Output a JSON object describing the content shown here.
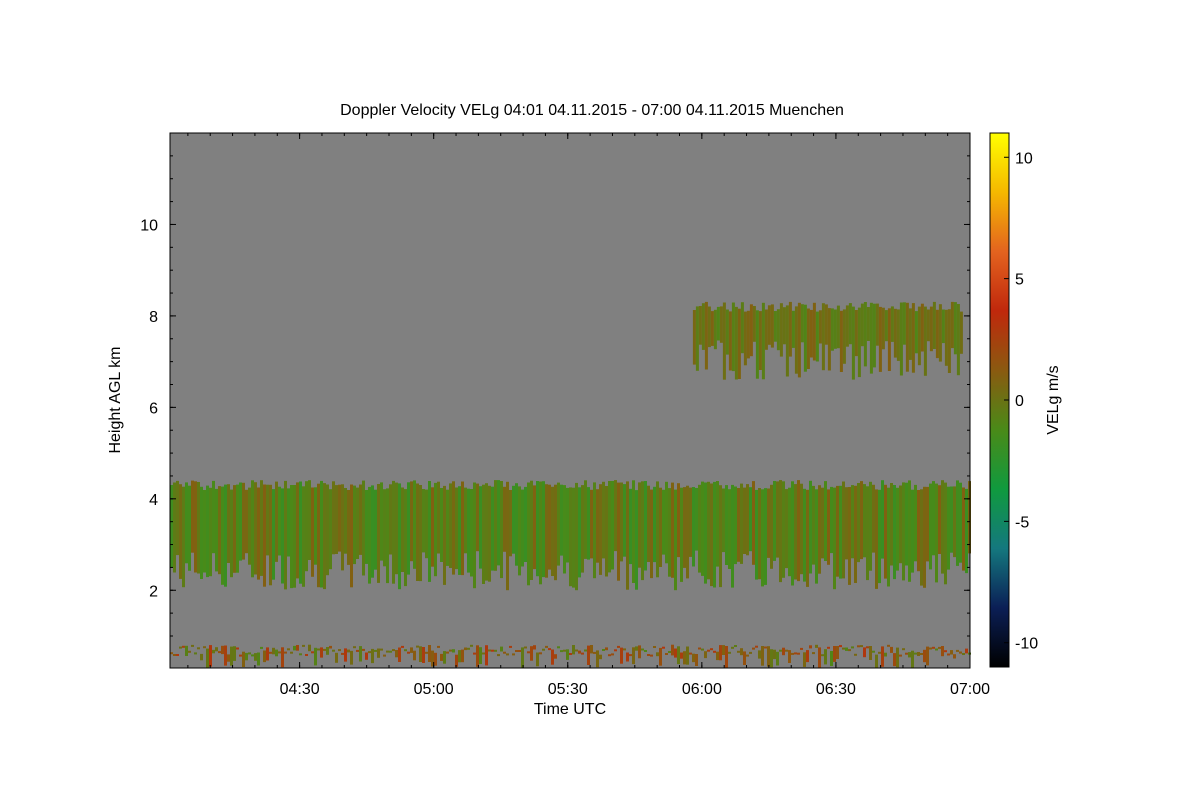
{
  "chart_data": {
    "type": "heatmap",
    "title": "Doppler Velocity VELg   04:01 04.11.2015 - 07:00 04.11.2015 Muenchen",
    "xlabel": "Time UTC",
    "ylabel": "Height AGL km",
    "xlim": [
      "04:01",
      "07:00"
    ],
    "ylim": [
      0.3,
      12.0
    ],
    "xticks": [
      "04:30",
      "05:00",
      "05:30",
      "06:00",
      "06:30",
      "07:00"
    ],
    "yticks": [
      2,
      4,
      6,
      8,
      10
    ],
    "colorbar": {
      "label": "VELg m/s",
      "range": [
        -11,
        11
      ],
      "ticks": [
        -10,
        -5,
        0,
        5,
        10
      ],
      "colors": [
        "#000000",
        "#0b1f56",
        "#14787e",
        "#109a3e",
        "#4a8a18",
        "#8a5a10",
        "#c0280c",
        "#e3631f",
        "#f5b800",
        "#ffff00"
      ]
    },
    "background_color": "#808080",
    "features": [
      {
        "name": "cloud layer",
        "start": "04:01",
        "end": "07:00",
        "base_km": 2.0,
        "top_km": 4.3,
        "velocity_ms": [
          -2,
          1
        ]
      },
      {
        "name": "upper cloud",
        "start": "05:58",
        "end": "06:58",
        "base_km": 6.6,
        "top_km": 8.2,
        "velocity_ms": [
          -1,
          1
        ]
      },
      {
        "name": "lower layer",
        "start": "04:01",
        "end": "07:00",
        "base_km": 0.3,
        "top_km": 0.7,
        "velocity_ms": [
          -1,
          3
        ]
      }
    ]
  }
}
